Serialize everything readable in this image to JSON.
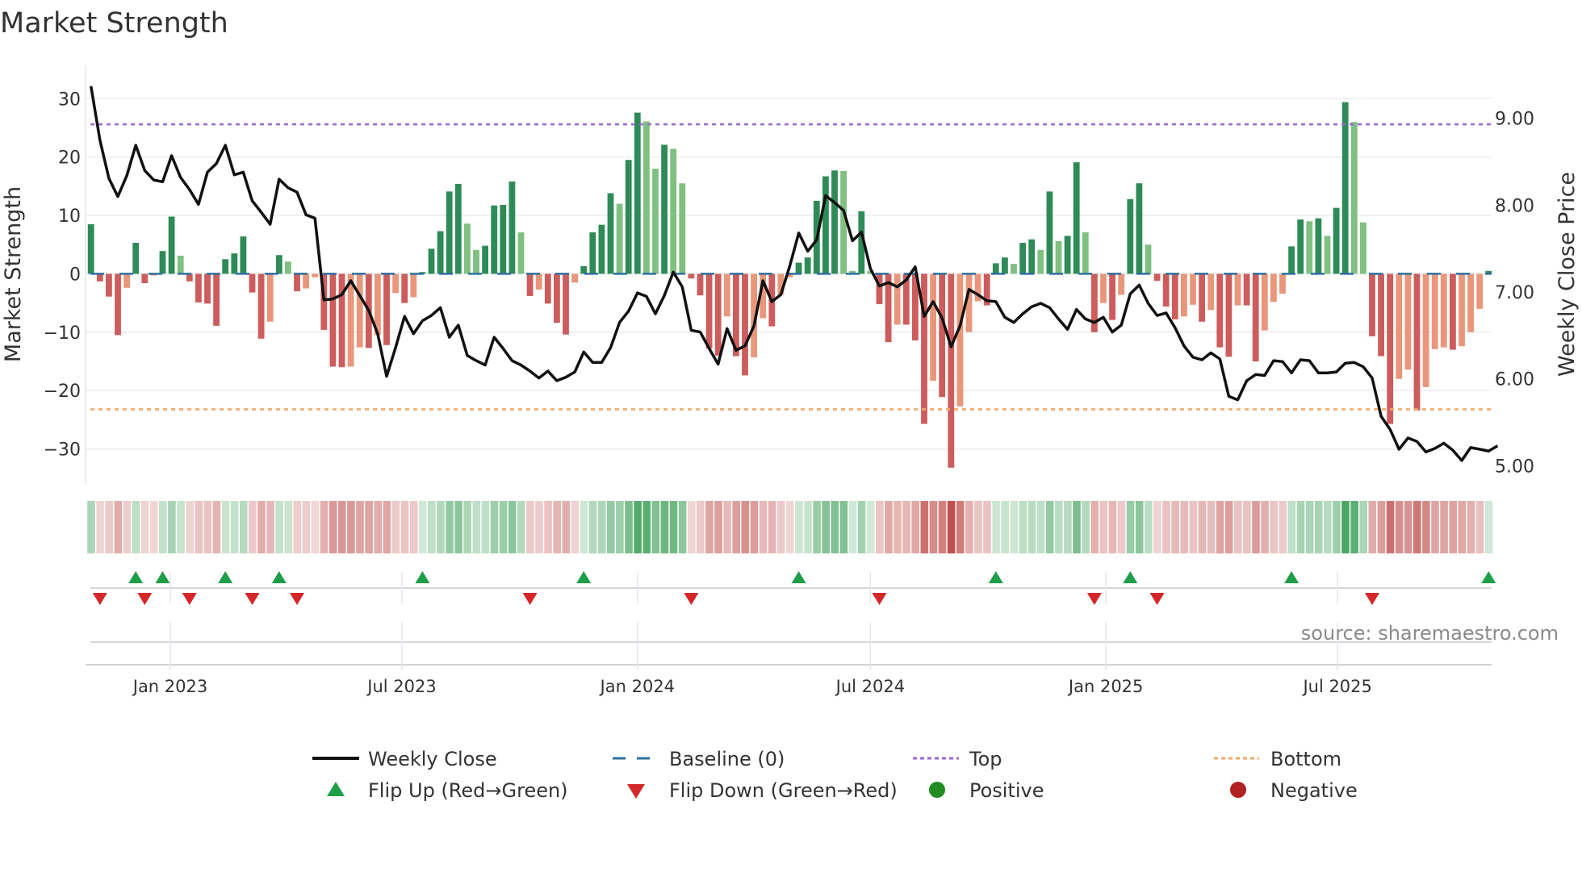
{
  "chart_data": {
    "type": "bar",
    "title": "Market Strength",
    "ylabel": "Market Strength",
    "y2label": "Weekly Close Price",
    "ylim": [
      -36,
      35.7
    ],
    "y2lim": [
      4.79,
      9.61
    ],
    "yticks": [
      30,
      20,
      10,
      0,
      -10,
      -20,
      -30
    ],
    "ytick_labels": [
      "30",
      "20",
      "10",
      "0",
      "−10",
      "−20",
      "−30"
    ],
    "y2ticks": [
      9,
      8,
      7,
      6,
      5
    ],
    "y2tick_labels": [
      "9.00",
      "8.00",
      "7.00",
      "6.00",
      "5.00"
    ],
    "xticks": [
      {
        "date": "2023-01-01",
        "label": "Jan 2023"
      },
      {
        "date": "2023-07-01",
        "label": "Jul 2023"
      },
      {
        "date": "2024-01-01",
        "label": "Jan 2024"
      },
      {
        "date": "2024-07-01",
        "label": "Jul 2024"
      },
      {
        "date": "2025-01-01",
        "label": "Jan 2025"
      },
      {
        "date": "2025-07-01",
        "label": "Jul 2025"
      }
    ],
    "x_start_week": "2022-10-31",
    "x_interval_days": 7,
    "grid": true,
    "top_level": 25.6,
    "bottom_level": -23.2,
    "baseline": 0,
    "strength": [
      8.5,
      -1.3,
      -3.9,
      -10.5,
      -2.4,
      5.3,
      -1.6,
      -0.3,
      3.9,
      9.8,
      3.1,
      -1.3,
      -4.9,
      -5.1,
      -8.9,
      2.5,
      3.5,
      6.4,
      -3.2,
      -11.1,
      -8.2,
      3.2,
      2.1,
      -3.0,
      -2.5,
      -0.6,
      -9.6,
      -15.9,
      -16.0,
      -15.9,
      -12.6,
      -12.7,
      -10.5,
      -12.2,
      -3.3,
      -5.0,
      -4.0,
      0.3,
      4.3,
      7.3,
      14.1,
      15.4,
      8.6,
      4.1,
      4.8,
      11.7,
      11.8,
      15.8,
      7.1,
      -3.8,
      -2.7,
      -5.1,
      -8.4,
      -10.4,
      -1.5,
      1.3,
      7.1,
      8.4,
      13.8,
      12.0,
      19.5,
      27.6,
      26.1,
      18.0,
      22.1,
      21.4,
      15.5,
      -0.8,
      -3.7,
      -12.8,
      -14.0,
      -7.3,
      -14.1,
      -17.4,
      -14.3,
      -7.6,
      -9.0,
      -3.6,
      -0.6,
      1.9,
      2.8,
      12.5,
      16.7,
      17.7,
      17.6,
      0.5,
      10.7,
      0.5,
      -5.2,
      -11.7,
      -8.7,
      -8.7,
      -11.4,
      -25.7,
      -18.3,
      -21.1,
      -33.2,
      -22.7,
      -10.0,
      -4.7,
      -5.4,
      1.8,
      2.8,
      1.7,
      5.3,
      5.9,
      4.1,
      14.1,
      5.6,
      6.5,
      19.1,
      7.1,
      -10.0,
      -5.0,
      -7.9,
      -3.6,
      12.8,
      15.5,
      5.0,
      -1.2,
      -5.6,
      -7.8,
      -7.3,
      -5.3,
      -8.2,
      -6.2,
      -12.6,
      -14.2,
      -5.4,
      -5.4,
      -15.0,
      -9.7,
      -4.8,
      -3.4,
      4.7,
      9.3,
      9.0,
      9.5,
      6.5,
      11.3,
      29.4,
      26.0,
      8.8,
      -10.7,
      -14.1,
      -25.7,
      -18.0,
      -16.4,
      -23.4,
      -19.4,
      -12.9,
      -12.6,
      -13.0,
      -12.4,
      -10.0,
      -6.0,
      0.5
    ],
    "weekly_close": [
      9.37,
      8.75,
      8.31,
      8.1,
      8.34,
      8.69,
      8.4,
      8.29,
      8.27,
      8.57,
      8.32,
      8.18,
      8.01,
      8.38,
      8.48,
      8.69,
      8.35,
      8.38,
      8.05,
      7.92,
      7.78,
      8.3,
      8.2,
      8.15,
      7.89,
      7.85,
      6.91,
      6.92,
      6.97,
      7.13,
      6.96,
      6.79,
      6.52,
      6.03,
      6.36,
      6.72,
      6.52,
      6.67,
      6.73,
      6.82,
      6.48,
      6.62,
      6.27,
      6.21,
      6.16,
      6.48,
      6.35,
      6.21,
      6.16,
      6.09,
      6.01,
      6.09,
      5.98,
      6.02,
      6.08,
      6.31,
      6.19,
      6.19,
      6.36,
      6.65,
      6.78,
      6.99,
      6.95,
      6.75,
      6.96,
      7.23,
      7.06,
      6.56,
      6.54,
      6.35,
      6.17,
      6.58,
      6.33,
      6.38,
      6.61,
      7.13,
      6.89,
      6.97,
      7.3,
      7.68,
      7.47,
      7.6,
      8.11,
      8.03,
      7.94,
      7.59,
      7.69,
      7.27,
      7.07,
      7.11,
      7.06,
      7.14,
      7.29,
      6.72,
      6.89,
      6.7,
      6.37,
      6.61,
      7.03,
      6.97,
      6.9,
      6.89,
      6.71,
      6.65,
      6.75,
      6.83,
      6.87,
      6.82,
      6.69,
      6.57,
      6.8,
      6.69,
      6.65,
      6.71,
      6.54,
      6.62,
      6.98,
      7.08,
      6.87,
      6.73,
      6.76,
      6.59,
      6.38,
      6.25,
      6.22,
      6.3,
      6.23,
      5.8,
      5.76,
      5.98,
      6.05,
      6.04,
      6.21,
      6.2,
      6.07,
      6.22,
      6.21,
      6.07,
      6.07,
      6.08,
      6.18,
      6.19,
      6.14,
      6.01,
      5.57,
      5.42,
      5.19,
      5.32,
      5.28,
      5.16,
      5.2,
      5.26,
      5.18,
      5.06,
      5.21,
      5.19,
      5.17,
      5.23
    ],
    "legend": {
      "placement": "bottom",
      "items": [
        {
          "key": "close",
          "label": "Weekly Close"
        },
        {
          "key": "baseline",
          "label": "Baseline (0)"
        },
        {
          "key": "top",
          "label": "Top"
        },
        {
          "key": "bottom",
          "label": "Bottom"
        },
        {
          "key": "flip_up",
          "label": "Flip Up (Red→Green)"
        },
        {
          "key": "flip_down",
          "label": "Flip Down (Green→Red)"
        },
        {
          "key": "positive",
          "label": "Positive"
        },
        {
          "key": "negative",
          "label": "Negative"
        }
      ]
    },
    "source": "source: sharemaestro.com"
  },
  "colors": {
    "pos_rising": "#2e8b57",
    "pos_falling": "#80c080",
    "neg_falling": "#cd5c5c",
    "neg_rising": "#e9967a",
    "close": "#111111",
    "baseline": "#2f6f9f",
    "top": "#9d65d5",
    "bottom": "#f0a868",
    "flip_up": "#1e9e48",
    "flip_down": "#d62728",
    "positive": "#228b22",
    "negative": "#b22222",
    "grid": "#e8ebf0",
    "heat_pos": "#3a9d55",
    "heat_neg": "#c0504d"
  }
}
